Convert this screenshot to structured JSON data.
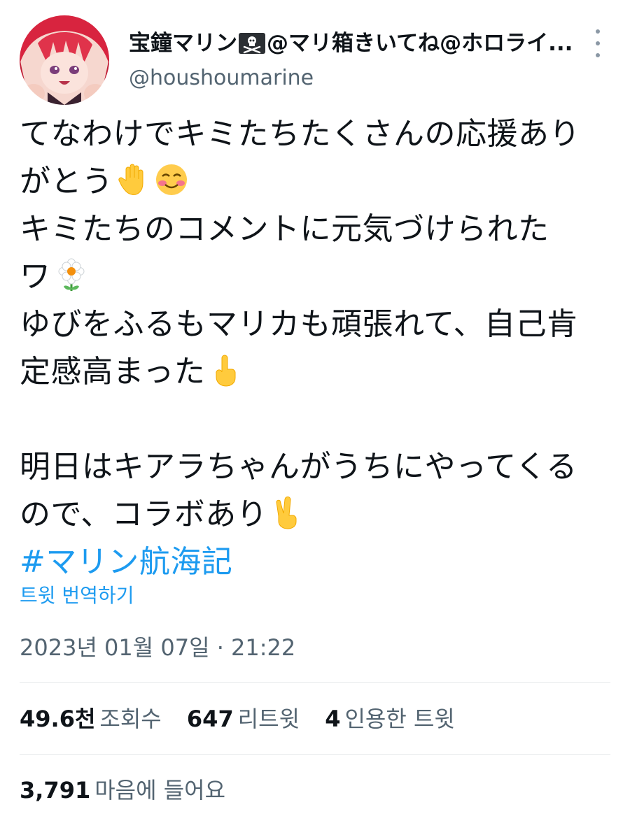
{
  "author": {
    "display_name_prefix": "宝鐘マリン",
    "display_name_suffix": "@マリ箱きいてね@ホロライ...",
    "flag_icon": "pirate-flag-icon",
    "handle": "@houshoumarine",
    "avatar_icon": "avatar-anime-girl"
  },
  "tweet": {
    "lines": [
      "てなわけでキミたちたくさんの応援あり",
      "がとう",
      "キミたちのコメントに元気づけられた",
      "ワ",
      "ゆびをふるもマリカも頑張れて、自己肯",
      "定感高まった",
      "明日はキアラちゃんがうちにやってくる",
      "ので、コラボあり"
    ],
    "hashtag": "#マリン航海記",
    "emoji_names": [
      "raised-hand-emoji",
      "smiling-blush-emoji",
      "white-flower-emoji",
      "pointing-up-emoji",
      "victory-hand-emoji"
    ]
  },
  "translate_label": "트윗 번역하기",
  "timestamp": "2023년 01월 07일 · 21:22",
  "stats": {
    "views_value": "49.6천",
    "views_label": "조회수",
    "retweets_value": "647",
    "retweets_label": "리트윗",
    "quotes_value": "4",
    "quotes_label": "인용한 트윗",
    "likes_value": "3,791",
    "likes_label": "마음에 들어요"
  },
  "colors": {
    "link": "#1d9bf0",
    "secondary_text": "#536471",
    "primary_text": "#0f1419",
    "avatar_hair": "#d8243f"
  }
}
